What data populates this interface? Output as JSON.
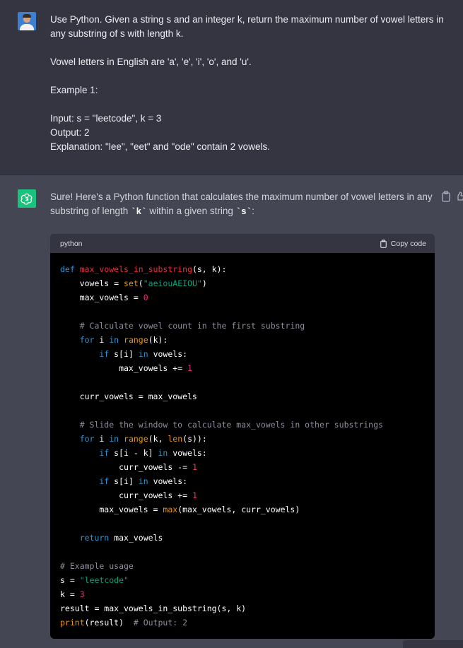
{
  "user": {
    "lines": [
      "Use Python. Given a string s and an integer k, return the maximum number of vowel letters in any substring of s with length k.",
      "",
      "Vowel letters in English are 'a', 'e', 'i', 'o', and 'u'.",
      "",
      "Example 1:",
      "",
      "Input: s = \"leetcode\", k = 3",
      "Output: 2",
      "Explanation: \"lee\", \"eet\" and \"ode\" contain 2 vowels."
    ]
  },
  "assistant": {
    "intro_part1": "Sure! Here's a Python function that calculates the maximum number of vowel letters in any substring of length ",
    "intro_code1": "`k`",
    "intro_part2": " within a given string ",
    "intro_code2": "`s`",
    "intro_part3": ":",
    "code_block": {
      "language": "python",
      "copy_label": "Copy code",
      "lines": [
        [
          [
            "kw",
            "def "
          ],
          [
            "fn",
            "max_vowels_in_substring"
          ],
          [
            "",
            "(s, k):"
          ]
        ],
        [
          [
            "",
            "    vowels = "
          ],
          [
            "bi",
            "set"
          ],
          [
            "",
            "("
          ],
          [
            "str",
            "\"aeiouAEIOU\""
          ],
          [
            "",
            ")"
          ]
        ],
        [
          [
            "",
            "    max_vowels = "
          ],
          [
            "num",
            "0"
          ]
        ],
        [],
        [
          [
            "cm",
            "    # Calculate vowel count in the first substring"
          ]
        ],
        [
          [
            "kw",
            "    for "
          ],
          [
            "",
            "i "
          ],
          [
            "kw",
            "in "
          ],
          [
            "bi",
            "range"
          ],
          [
            "",
            "(k):"
          ]
        ],
        [
          [
            "kw",
            "        if "
          ],
          [
            "",
            "s[i] "
          ],
          [
            "kw",
            "in "
          ],
          [
            "",
            "vowels:"
          ]
        ],
        [
          [
            "",
            "            max_vowels += "
          ],
          [
            "num",
            "1"
          ]
        ],
        [],
        [
          [
            "",
            "    curr_vowels = max_vowels"
          ]
        ],
        [],
        [
          [
            "cm",
            "    # Slide the window to calculate max_vowels in other substrings"
          ]
        ],
        [
          [
            "kw",
            "    for "
          ],
          [
            "",
            "i "
          ],
          [
            "kw",
            "in "
          ],
          [
            "bi",
            "range"
          ],
          [
            "",
            "(k, "
          ],
          [
            "bi",
            "len"
          ],
          [
            "",
            "(s)):"
          ]
        ],
        [
          [
            "kw",
            "        if "
          ],
          [
            "",
            "s[i - k] "
          ],
          [
            "kw",
            "in "
          ],
          [
            "",
            "vowels:"
          ]
        ],
        [
          [
            "",
            "            curr_vowels -= "
          ],
          [
            "num",
            "1"
          ]
        ],
        [
          [
            "kw",
            "        if "
          ],
          [
            "",
            "s[i] "
          ],
          [
            "kw",
            "in "
          ],
          [
            "",
            "vowels:"
          ]
        ],
        [
          [
            "",
            "            curr_vowels += "
          ],
          [
            "num",
            "1"
          ]
        ],
        [
          [
            "",
            "        max_vowels = "
          ],
          [
            "bi",
            "max"
          ],
          [
            "",
            "(max_vowels, curr_vowels)"
          ]
        ],
        [],
        [
          [
            "kw",
            "    return "
          ],
          [
            "",
            "max_vowels"
          ]
        ],
        [],
        [
          [
            "cm",
            "# Example usage"
          ]
        ],
        [
          [
            "",
            "s = "
          ],
          [
            "str",
            "\"leetcode\""
          ]
        ],
        [
          [
            "",
            "k = "
          ],
          [
            "num",
            "3"
          ]
        ],
        [
          [
            "",
            "result = max_vowels_in_substring(s, k)"
          ]
        ],
        [
          [
            "bi",
            "print"
          ],
          [
            "",
            "(result)  "
          ],
          [
            "cm",
            "# Output: 2"
          ]
        ]
      ]
    }
  },
  "icons": {
    "user_avatar": "avatar",
    "assistant_avatar": "chatgpt-logo-icon",
    "copy": "clipboard-icon",
    "feedback": "thumbs-up-icon"
  },
  "colors": {
    "user_bg": "#343541",
    "assistant_bg": "#444654",
    "brand_green": "#19c37d",
    "code_bg": "#000000"
  }
}
